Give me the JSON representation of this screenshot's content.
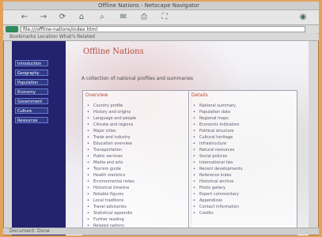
{
  "window": {
    "title": "Offline Nations - Netscape Navigator"
  },
  "toolbar": {
    "buttons": [
      {
        "label": "←",
        "name": "back-button"
      },
      {
        "label": "→",
        "name": "forward-button"
      },
      {
        "label": "⟳",
        "name": "reload-button"
      },
      {
        "label": "⌂",
        "name": "home-button"
      },
      {
        "label": "⌕",
        "name": "search-button"
      },
      {
        "label": "✉",
        "name": "mail-button"
      },
      {
        "label": "⎙",
        "name": "print-button"
      },
      {
        "label": "⛶",
        "name": "security-button"
      },
      {
        "label": "◉",
        "name": "stop-button"
      }
    ]
  },
  "address": {
    "value": "file:///offline-nations/index.html"
  },
  "links": {
    "text": "Bookmarks  Location  What's Related"
  },
  "sidebar": {
    "items": [
      {
        "label": "Introduction"
      },
      {
        "label": "Geography"
      },
      {
        "label": "Population"
      },
      {
        "label": "Economy"
      },
      {
        "label": "Government"
      },
      {
        "label": "Culture"
      },
      {
        "label": "Resources"
      }
    ]
  },
  "page": {
    "title": "Offline Nations",
    "note": "A collection of national profiles and summaries",
    "left_heading": "Overview",
    "right_heading": "Details",
    "left_items": [
      "Country profile",
      "History and origins",
      "Language and people",
      "Climate and regions",
      "Major cities",
      "Trade and industry",
      "Education overview",
      "Transportation",
      "Public services",
      "Media and arts",
      "Tourism guide",
      "Health statistics",
      "Environmental notes",
      "Historical timeline",
      "Notable figures",
      "Local traditions",
      "Travel advisories",
      "Statistical appendix",
      "Further reading",
      "Related nations"
    ],
    "right_items": [
      "National summary",
      "Population data",
      "Regional maps",
      "Economic indicators",
      "Political structure",
      "Cultural heritage",
      "Infrastructure",
      "Natural resources",
      "Social policies",
      "International ties",
      "Recent developments",
      "Reference index",
      "Historical archive",
      "Photo gallery",
      "Expert commentary",
      "Appendices",
      "Contact information",
      "Credits"
    ]
  },
  "status": {
    "text": "Document: Done"
  }
}
